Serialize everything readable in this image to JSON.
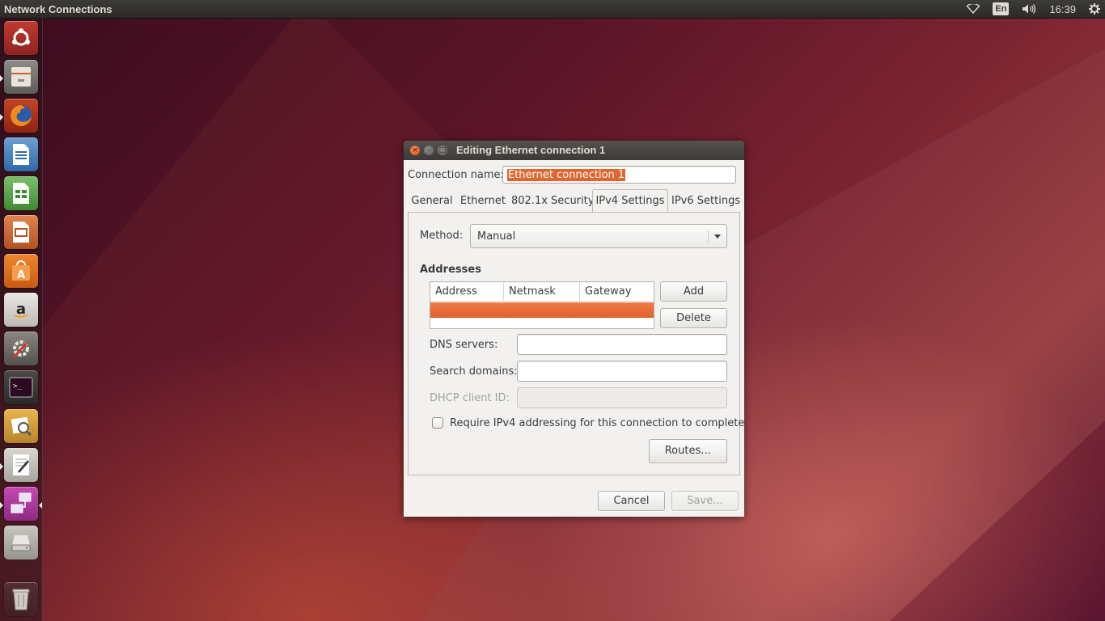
{
  "top_panel": {
    "title": "Network Connections",
    "tray": {
      "network_icon": "wifi-icon",
      "keyboard_layout": "En",
      "volume_icon": "volume-icon",
      "clock": "16:39",
      "settings_icon": "gear-icon"
    }
  },
  "launcher": {
    "items": [
      {
        "name": "ubuntu-dash-icon"
      },
      {
        "name": "files-icon"
      },
      {
        "name": "firefox-icon"
      },
      {
        "name": "libreoffice-writer-icon"
      },
      {
        "name": "libreoffice-calc-icon"
      },
      {
        "name": "libreoffice-impress-icon"
      },
      {
        "name": "software-center-icon"
      },
      {
        "name": "amazon-icon"
      },
      {
        "name": "system-settings-icon"
      },
      {
        "name": "terminal-icon"
      },
      {
        "name": "image-viewer-icon"
      },
      {
        "name": "text-editor-icon"
      },
      {
        "name": "network-connections-icon"
      },
      {
        "name": "drive-icon"
      },
      {
        "name": "trash-icon"
      }
    ]
  },
  "dialog": {
    "title": "Editing Ethernet connection 1",
    "connection_name_label": "Connection name:",
    "connection_name_value": "Ethernet connection 1",
    "tabs": [
      {
        "label": "General"
      },
      {
        "label": "Ethernet"
      },
      {
        "label": "802.1x Security"
      },
      {
        "label": "IPv4 Settings"
      },
      {
        "label": "IPv6 Settings"
      }
    ],
    "active_tab": "IPv4 Settings",
    "method_label": "Method:",
    "method_value": "Manual",
    "addresses_title": "Addresses",
    "addresses_columns": [
      "Address",
      "Netmask",
      "Gateway"
    ],
    "add_label": "Add",
    "delete_label": "Delete",
    "dns_label": "DNS servers:",
    "dns_value": "",
    "search_domains_label": "Search domains:",
    "search_domains_value": "",
    "dhcp_client_id_label": "DHCP client ID:",
    "dhcp_client_id_value": "",
    "require_ipv4_label": "Require IPv4 addressing for this connection to complete",
    "require_ipv4_checked": false,
    "routes_label": "Routes…",
    "cancel_label": "Cancel",
    "save_label": "Save..."
  },
  "colors": {
    "accent": "#e0602a",
    "panel": "#3c3b37"
  }
}
